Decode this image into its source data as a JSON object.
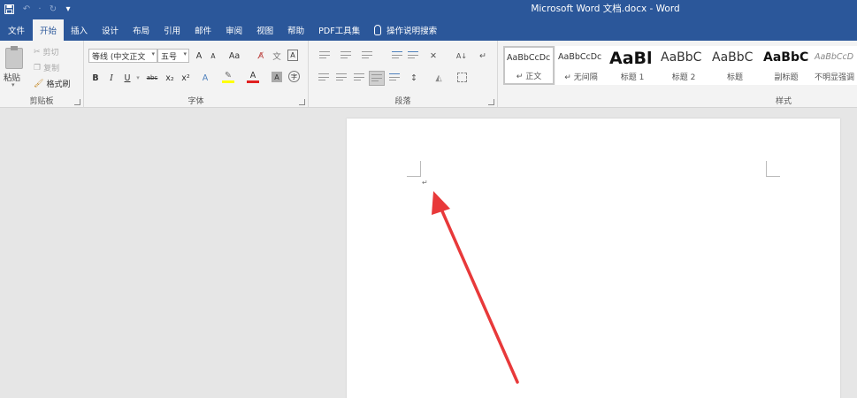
{
  "titlebar": {
    "title": "Microsoft Word 文档.docx - Word",
    "save_icon": "save-icon",
    "undo_icon": "undo-icon",
    "redo_icon": "redo-icon",
    "customize_icon": "customize-qat-icon"
  },
  "tabs": [
    {
      "label": "文件"
    },
    {
      "label": "开始"
    },
    {
      "label": "插入"
    },
    {
      "label": "设计"
    },
    {
      "label": "布局"
    },
    {
      "label": "引用"
    },
    {
      "label": "邮件"
    },
    {
      "label": "审阅"
    },
    {
      "label": "视图"
    },
    {
      "label": "帮助"
    },
    {
      "label": "PDF工具集"
    }
  ],
  "active_tab": "开始",
  "tell_me": "操作说明搜索",
  "clipboard": {
    "paste": "粘贴",
    "cut": "剪切",
    "copy": "复制",
    "format_painter": "格式刷",
    "group_label": "剪贴板"
  },
  "font": {
    "font_name": "等线 (中文正文",
    "font_size": "五号",
    "grow": "A",
    "shrink": "A",
    "case": "Aa",
    "bold": "B",
    "italic": "I",
    "underline": "U",
    "strike": "abc",
    "subscript": "x₂",
    "superscript": "x²",
    "group_label": "字体"
  },
  "paragraph": {
    "group_label": "段落",
    "sort": "A↓"
  },
  "styles": {
    "group_label": "样式",
    "items": [
      {
        "sample": "AaBbCcDc",
        "name": "↵ 正文"
      },
      {
        "sample": "AaBbCcDc",
        "name": "↵ 无间隔"
      },
      {
        "sample": "AaBl",
        "name": "标题 1"
      },
      {
        "sample": "AaBbC",
        "name": "标题 2"
      },
      {
        "sample": "AaBbC",
        "name": "标题"
      },
      {
        "sample": "AaBbC",
        "name": "副标题"
      },
      {
        "sample": "AaBbCcD",
        "name": "不明显强调"
      }
    ]
  },
  "document": {
    "paragraph_mark": "↵"
  },
  "colors": {
    "accent": "#2b579a",
    "arrow": "#e8393a"
  }
}
